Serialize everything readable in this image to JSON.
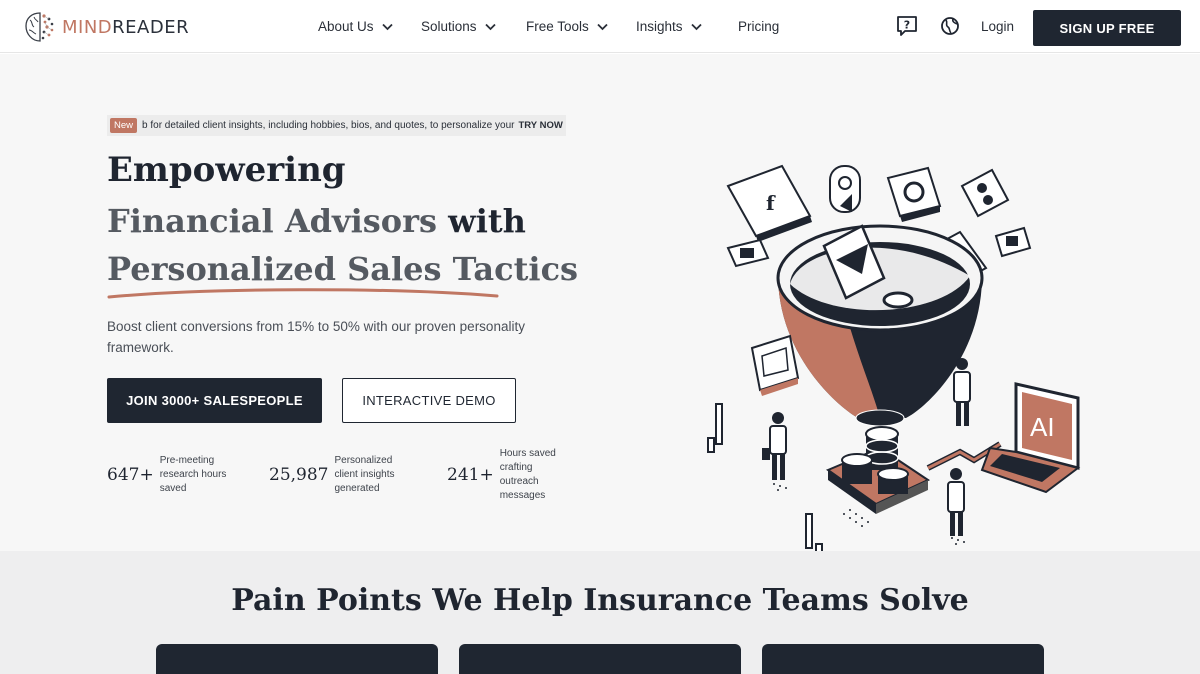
{
  "brand": {
    "name_part1": "MIND",
    "name_part2": "READER",
    "accent_color": "#c07763",
    "dark_color": "#1f2631"
  },
  "nav": {
    "items": [
      {
        "label": "About Us",
        "has_dropdown": true
      },
      {
        "label": "Solutions",
        "has_dropdown": true
      },
      {
        "label": "Free Tools",
        "has_dropdown": true
      },
      {
        "label": "Insights",
        "has_dropdown": true
      },
      {
        "label": "Pricing",
        "has_dropdown": false
      }
    ],
    "icons": [
      "help-chat-icon",
      "globe-icon"
    ],
    "login_label": "Login",
    "signup_label": "SIGN UP FREE"
  },
  "hero": {
    "badge": "New",
    "banner_text": "b for detailed client insights, including hobbies, bios, and quotes, to personalize your",
    "banner_cta": "TRY NOW",
    "headline_line1": "Empowering",
    "headline_line2_grey": "Financial Advisors",
    "headline_line2_dark": "with",
    "headline_line3": "Personalized Sales Tactics",
    "subtitle": "Boost client conversions from 15% to 50% with our proven personality framework.",
    "primary_cta": "JOIN 3000+ SALESPEOPLE",
    "secondary_cta": "INTERACTIVE DEMO",
    "stats": [
      {
        "value": "647+",
        "label_lines": [
          "Pre-meeting",
          "research hours",
          "saved"
        ]
      },
      {
        "value": "25,987",
        "label_lines": [
          "Personalized",
          "client insights",
          "generated"
        ]
      },
      {
        "value": "241+",
        "label_lines": [
          "Hours saved",
          "crafting",
          "outreach",
          "messages"
        ]
      }
    ],
    "illustration_text": "AI"
  },
  "section2": {
    "title": "Pain Points We Help Insurance Teams Solve"
  }
}
